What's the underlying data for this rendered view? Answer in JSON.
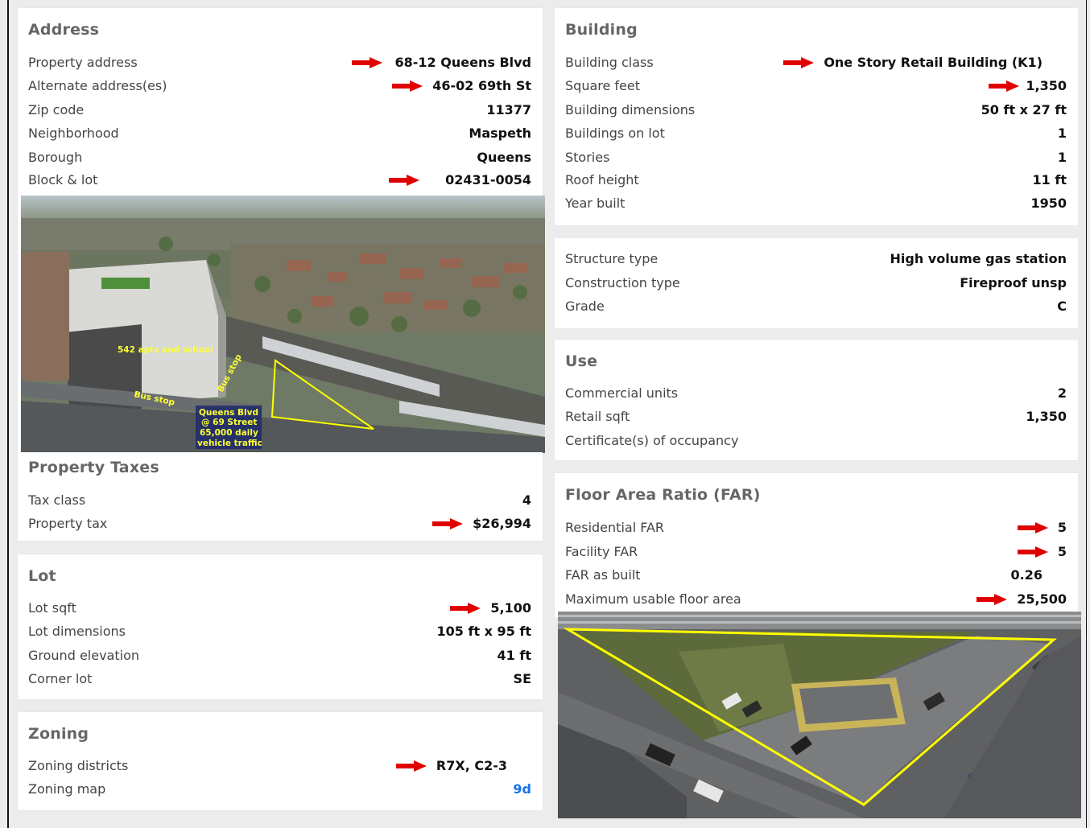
{
  "address": {
    "title": "Address",
    "rows": [
      {
        "label": "Property address",
        "value": "68-12 Queens Blvd"
      },
      {
        "label": "Alternate address(es)",
        "value": "46-02 69th St"
      },
      {
        "label": "Zip code",
        "value": "11377"
      },
      {
        "label": "Neighborhood",
        "value": "Maspeth"
      },
      {
        "label": "Borough",
        "value": "Queens"
      },
      {
        "label": "Block & lot",
        "value": "02431-0054"
      }
    ]
  },
  "aerial_photo": {
    "captions": {
      "apts": "542 apts and school",
      "bus1": "Bus stop",
      "bus2": "Bus stop",
      "traffic_1": "Queens Blvd",
      "traffic_2": "@ 69 Street",
      "traffic_3": "65,000 daily",
      "traffic_4": "vehicle traffic"
    }
  },
  "property_taxes": {
    "title": "Property Taxes",
    "rows": [
      {
        "label": "Tax class",
        "value": "4"
      },
      {
        "label": "Property tax",
        "value": "$26,994"
      }
    ]
  },
  "lot": {
    "title": "Lot",
    "rows": [
      {
        "label": "Lot sqft",
        "value": "5,100"
      },
      {
        "label": "Lot dimensions",
        "value": "105 ft x 95 ft"
      },
      {
        "label": "Ground elevation",
        "value": "41 ft"
      },
      {
        "label": "Corner lot",
        "value": "SE"
      }
    ]
  },
  "zoning": {
    "title": "Zoning",
    "rows": [
      {
        "label": "Zoning districts",
        "value": "R7X, C2-3"
      },
      {
        "label": "Zoning map",
        "value": "9d"
      }
    ]
  },
  "building": {
    "title": "Building",
    "rows": [
      {
        "label": "Building class",
        "value": "One Story Retail Building (K1)"
      },
      {
        "label": "Square feet",
        "value": "1,350"
      },
      {
        "label": "Building dimensions",
        "value": "50 ft x 27 ft"
      },
      {
        "label": "Buildings on lot",
        "value": "1"
      },
      {
        "label": "Stories",
        "value": "1"
      },
      {
        "label": "Roof height",
        "value": "11 ft"
      },
      {
        "label": "Year built",
        "value": "1950"
      }
    ]
  },
  "structure": {
    "rows": [
      {
        "label": "Structure type",
        "value": "High volume gas station"
      },
      {
        "label": "Construction type",
        "value": "Fireproof unsp"
      },
      {
        "label": "Grade",
        "value": "C"
      }
    ]
  },
  "use": {
    "title": "Use",
    "rows": [
      {
        "label": "Commercial units",
        "value": "2"
      },
      {
        "label": "Retail sqft",
        "value": "1,350"
      },
      {
        "label": "Certificate(s) of occupancy",
        "value": ""
      }
    ]
  },
  "far": {
    "title": "Floor Area Ratio (FAR)",
    "rows": [
      {
        "label": "Residential FAR",
        "value": "5"
      },
      {
        "label": "Facility FAR",
        "value": "5"
      },
      {
        "label": "FAR as built",
        "value": "0.26"
      },
      {
        "label": "Maximum usable floor area",
        "value": "25,500"
      }
    ]
  },
  "colors": {
    "arrow": "#e00000",
    "link": "#1a73e8",
    "outline": "#ffff00"
  }
}
